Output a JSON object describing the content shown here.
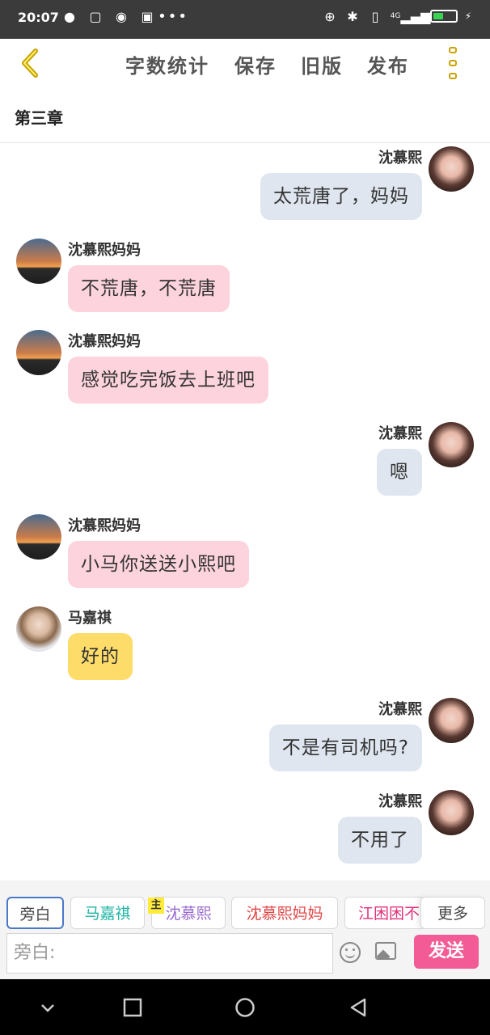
{
  "status_bar": {
    "time": "20:07",
    "network": "4G"
  },
  "toolbar": {
    "word_count": "字数统计",
    "save": "保存",
    "old_version": "旧版",
    "publish": "发布"
  },
  "chapter": {
    "title": "第三章"
  },
  "messages": [
    {
      "side": "right",
      "name": "沈慕熙",
      "text": "太荒唐了，妈妈"
    },
    {
      "side": "left",
      "name": "沈慕熙妈妈",
      "text": "不荒唐，不荒唐"
    },
    {
      "side": "left",
      "name": "沈慕熙妈妈",
      "text": "感觉吃完饭去上班吧"
    },
    {
      "side": "right",
      "name": "沈慕熙",
      "text": "嗯"
    },
    {
      "side": "left",
      "name": "沈慕熙妈妈",
      "text": "小马你送送小熙吧"
    },
    {
      "side": "left",
      "name": "马嘉祺",
      "text": "好的"
    },
    {
      "side": "right",
      "name": "沈慕熙",
      "text": "不是有司机吗?"
    },
    {
      "side": "right",
      "name": "沈慕熙",
      "text": "不用了"
    }
  ],
  "characters": [
    {
      "label": "旁白",
      "color": "#444444"
    },
    {
      "label": "马嘉祺",
      "color": "#1fb5a6"
    },
    {
      "label": "沈慕熙",
      "color": "#9b6bd1"
    },
    {
      "label": "沈慕熙妈妈",
      "color": "#e04848"
    },
    {
      "label": "江困困不",
      "color": "#e0307a"
    }
  ],
  "host_badge": "主",
  "more_label": "更多",
  "input": {
    "placeholder": "旁白:"
  },
  "send_label": "发送",
  "colors": {
    "accent": "#f25b95",
    "back_arrow": "#c9a300"
  }
}
